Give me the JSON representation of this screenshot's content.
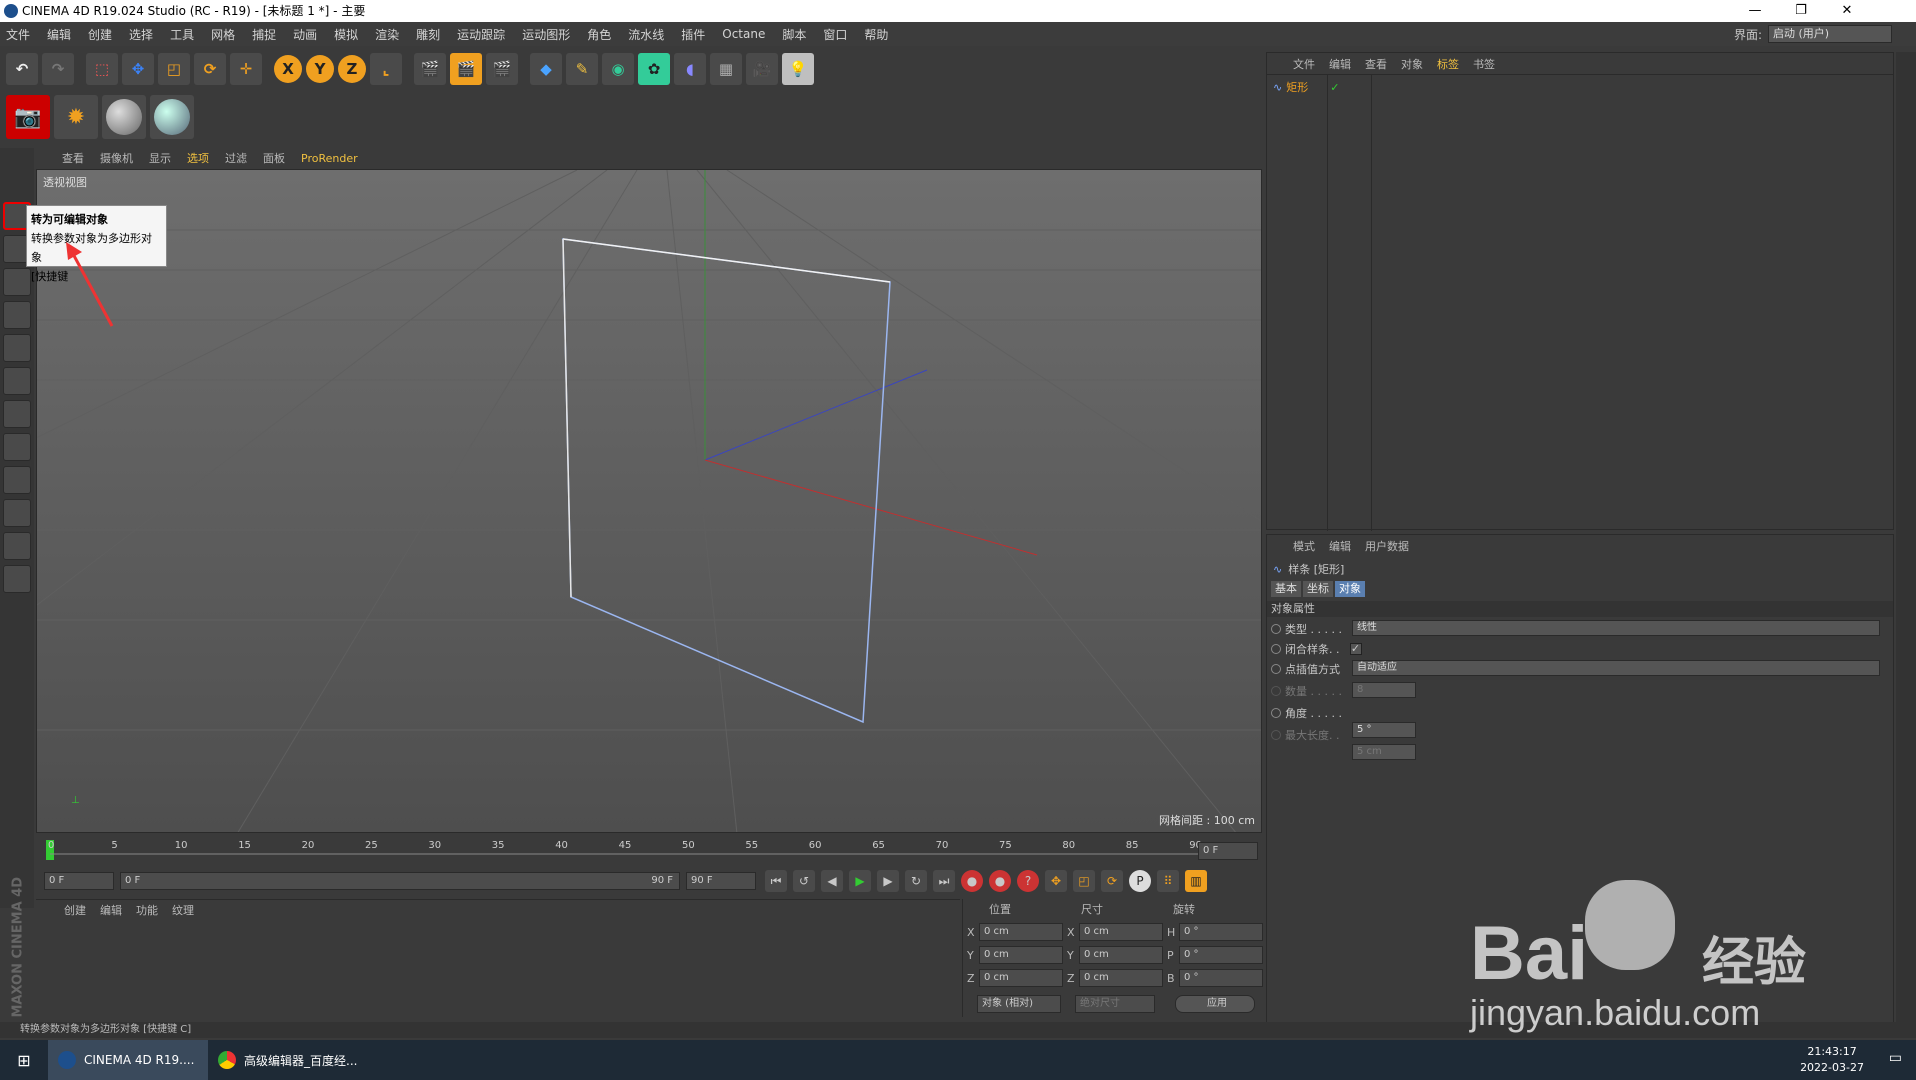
{
  "window": {
    "title": "CINEMA 4D R19.024 Studio (RC - R19) - [未标题 1 *] - 主要"
  },
  "menu": [
    "文件",
    "编辑",
    "创建",
    "选择",
    "工具",
    "网格",
    "捕捉",
    "动画",
    "模拟",
    "渲染",
    "雕刻",
    "运动跟踪",
    "运动图形",
    "角色",
    "流水线",
    "插件",
    "Octane",
    "脚本",
    "窗口",
    "帮助"
  ],
  "layout": {
    "label": "界面:",
    "value": "启动 (用户)"
  },
  "toolbar": {
    "x": "X",
    "y": "Y",
    "z": "Z"
  },
  "tooltip": {
    "title": "转为可编辑对象",
    "desc": "转换参数对象为多边形对象",
    "shortcut": "[快捷键"
  },
  "viewport": {
    "menu": [
      "查看",
      "摄像机",
      "显示",
      "选项",
      "过滤",
      "面板",
      "ProRender"
    ],
    "label": "透视视图",
    "grid": "网格间距 : 100 cm"
  },
  "timeline": {
    "ticks": [
      "0",
      "5",
      "10",
      "15",
      "20",
      "25",
      "30",
      "35",
      "40",
      "45",
      "50",
      "55",
      "60",
      "65",
      "70",
      "75",
      "80",
      "85",
      "90"
    ],
    "frame": "0 F"
  },
  "playbar": {
    "start": "0 F",
    "range_start": "0 F",
    "range_end": "90 F",
    "end": "90 F"
  },
  "material": {
    "menu": [
      "创建",
      "编辑",
      "功能",
      "纹理"
    ],
    "logo": "MAXON CINEMA 4D"
  },
  "coords": {
    "pos": "位置",
    "size": "尺寸",
    "rot": "旋转",
    "rows": [
      {
        "a": "X",
        "v1": "0 cm",
        "b": "X",
        "v2": "0 cm",
        "c": "H",
        "v3": "0 °"
      },
      {
        "a": "Y",
        "v1": "0 cm",
        "b": "Y",
        "v2": "0 cm",
        "c": "P",
        "v3": "0 °"
      },
      {
        "a": "Z",
        "v1": "0 cm",
        "b": "Z",
        "v2": "0 cm",
        "c": "B",
        "v3": "0 °"
      }
    ],
    "mode": "对象 (相对)",
    "size_mode": "绝对尺寸",
    "apply": "应用"
  },
  "objects": {
    "menu": [
      "文件",
      "编辑",
      "查看",
      "对象",
      "标签",
      "书签"
    ],
    "item": "矩形"
  },
  "attributes": {
    "menu": [
      "模式",
      "编辑",
      "用户数据"
    ],
    "object": "样条 [矩形]",
    "tabs": [
      "基本",
      "坐标",
      "对象"
    ],
    "section": "对象属性",
    "type_label": "类型 . . . . .",
    "type_value": "线性",
    "close_label": "闭合样条. .",
    "interp_label": "点插值方式",
    "interp_value": "自动适应",
    "count_label": "数量 . . . . .",
    "count_value": "8",
    "angle_label": "角度 . . . . .",
    "angle_value": "5 °",
    "maxlen_label": "最大长度. .",
    "maxlen_value": "5 cm"
  },
  "status": "转换参数对象为多边形对象 [快捷键 C]",
  "taskbar": {
    "c4d": "CINEMA 4D R19....",
    "chrome": "高级编辑器_百度经...",
    "time": "21:43:17",
    "date": "2022-03-27"
  },
  "watermark": {
    "brand": "Bai",
    "cn": "经验",
    "url": "jingyan.baidu.com"
  }
}
